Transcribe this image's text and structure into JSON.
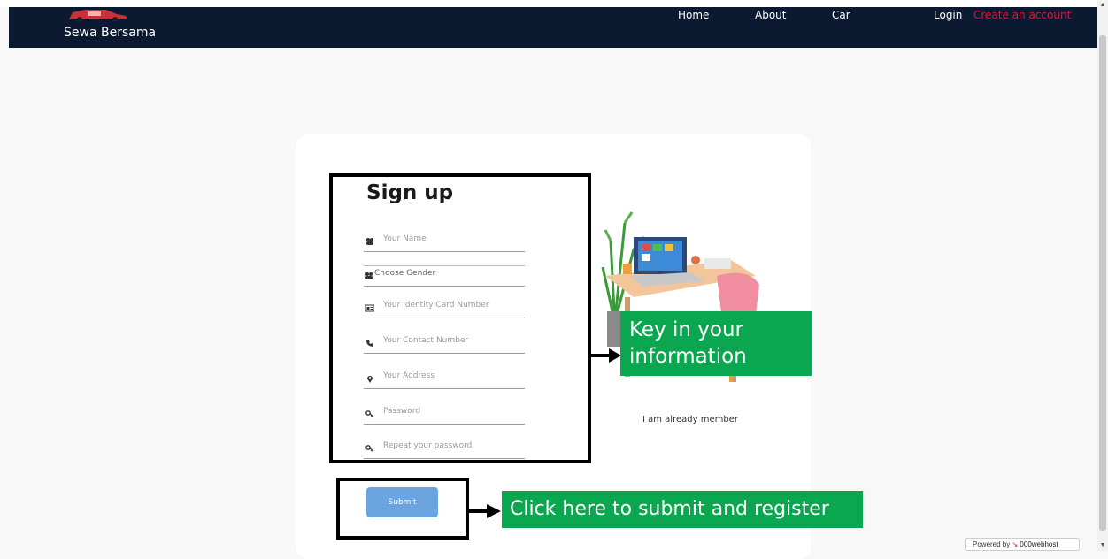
{
  "nav": {
    "brand": "Sewa Bersama",
    "links": {
      "home": "Home",
      "about": "About",
      "car": "Car",
      "login": "Login",
      "create": "Create an account"
    }
  },
  "form": {
    "title": "Sign up",
    "fields": {
      "name": "Your Name",
      "gender": "Choose Gender",
      "identity": "Your Identity Card Number",
      "contact": "Your Contact Number",
      "address": "Your Address",
      "password": "Password",
      "repeat": "Repeat your password"
    },
    "submit": "Submit",
    "member_link": "I am already member"
  },
  "annotations": {
    "info_callout": "Key in your information",
    "info_line1": "Key in your",
    "info_line2": "information",
    "submit_callout": "Click here to submit and register"
  },
  "footer": {
    "powered_prefix": "Powered by",
    "powered_brand": "000webhost"
  },
  "colors": {
    "navbar": "#0b1a30",
    "create_link": "#e0173a",
    "button": "#6aa5df",
    "callout": "#0aa650"
  },
  "icons": {
    "name": "users-icon",
    "gender": "users-icon",
    "identity": "id-card-icon",
    "contact": "phone-icon",
    "address": "map-pin-icon",
    "password": "key-icon",
    "repeat": "key-icon"
  }
}
